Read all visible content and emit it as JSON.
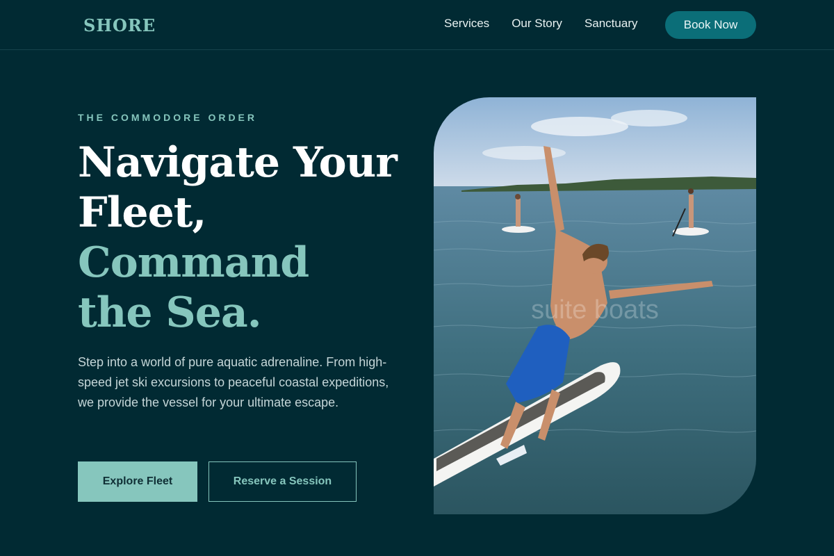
{
  "brand": {
    "logo": "SHORE"
  },
  "nav": {
    "links": [
      "Services",
      "Our Story",
      "Sanctuary"
    ],
    "cta": "Book Now"
  },
  "hero": {
    "eyebrow": "THE COMMODORE ORDER",
    "headline_line1": "Navigate Your",
    "headline_line2": "Fleet,",
    "headline_line3": "Command",
    "headline_line4": "the Sea.",
    "lead": "Step into a world of pure aquatic adrenaline. From high-speed jet ski excursions to peaceful coastal expeditions, we provide the vessel for your ultimate escape.",
    "primary_button": "Explore Fleet",
    "secondary_button": "Reserve a Session",
    "image_watermark": "suite boats"
  },
  "colors": {
    "background": "#012a33",
    "accent": "#86c6bd",
    "cta": "#0b6e78"
  }
}
